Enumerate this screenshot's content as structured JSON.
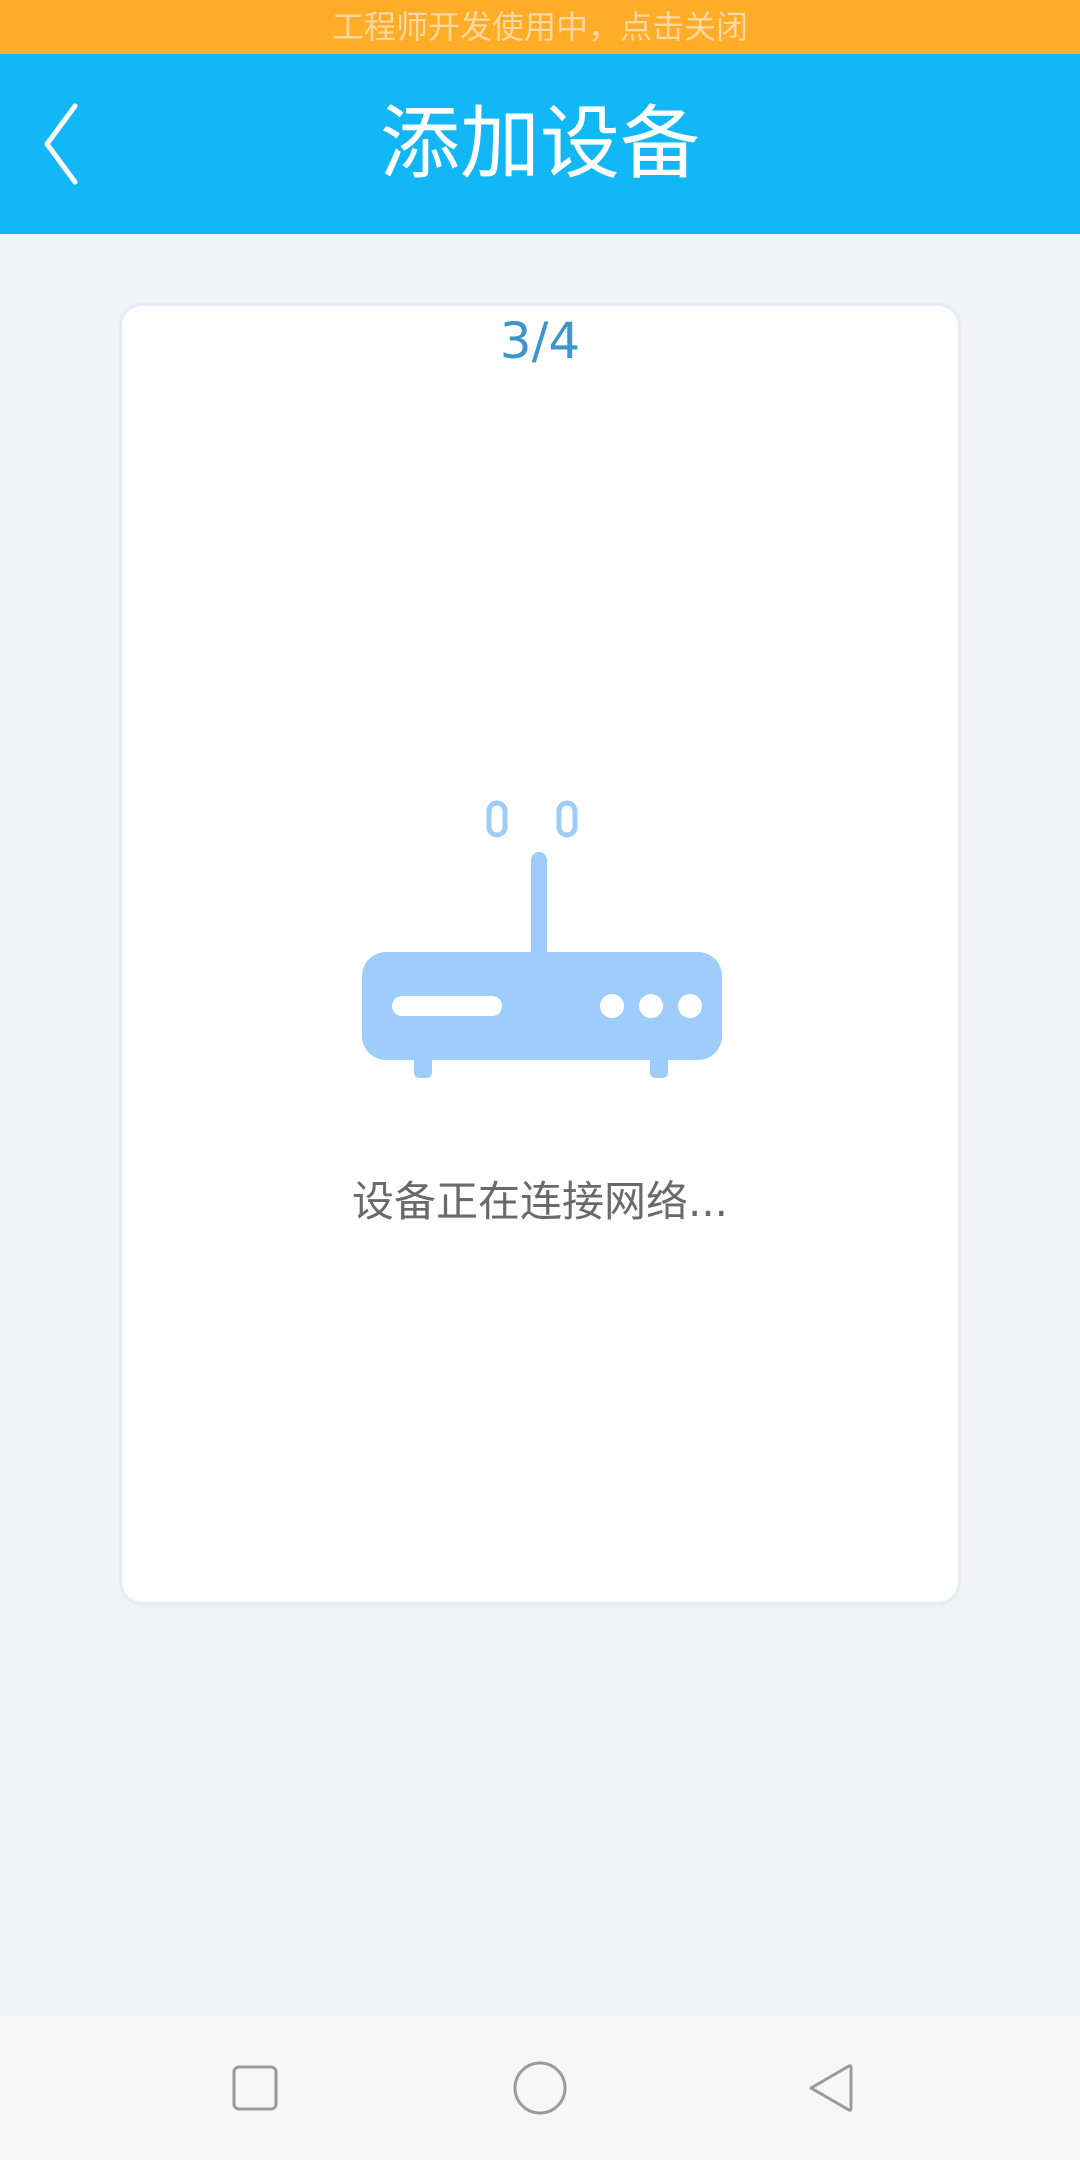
{
  "dev_banner": {
    "text": "工程师开发使用中，点击关闭"
  },
  "header": {
    "title": "添加设备",
    "back_icon": "chevron-left-icon"
  },
  "card": {
    "step": "3/4",
    "illustration_icon": "router-icon",
    "status_text": "设备正在连接网络..."
  },
  "nav_bar": {
    "recent_icon": "square-icon",
    "home_icon": "circle-icon",
    "back_icon": "triangle-back-icon"
  },
  "colors": {
    "banner_bg": "#ffad26",
    "header_bg": "#12b8f5",
    "step_text": "#3d95cb",
    "router_fill": "#9ecdfc",
    "page_bg": "#f0f2f5"
  }
}
